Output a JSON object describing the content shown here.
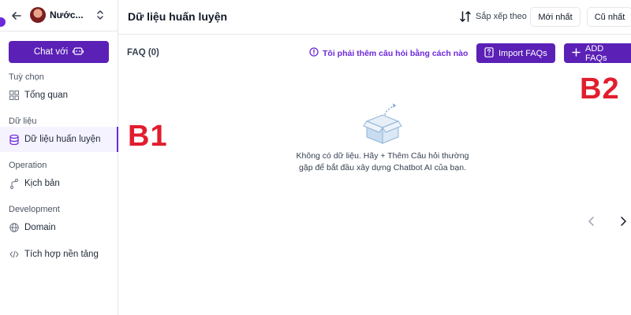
{
  "sidebar": {
    "account_name": "Nước...",
    "chat_button": "Chat với",
    "sections": {
      "options": "Tuỳ chọn",
      "data": "Dữ liệu",
      "operation": "Operation",
      "development": "Development"
    },
    "items": {
      "overview": "Tổng quan",
      "training": "Dữ liệu huấn luyện",
      "scenario": "Kịch bản",
      "domain": "Domain",
      "integration": "Tích hợp nền tảng"
    }
  },
  "header": {
    "title": "Dữ liệu huấn luyện",
    "sort_label": "Sắp xếp theo",
    "sort_newest": "Mới nhất",
    "sort_oldest": "Cũ nhất"
  },
  "content": {
    "faq_title": "FAQ (0)",
    "help_link": "Tôi phải thêm câu hỏi bằng cách nào",
    "import_button": "Import FAQs",
    "add_button": "ADD FAQs",
    "empty_line1": "Không có dữ liệu. Hãy + Thêm Câu hỏi thường",
    "empty_line2": "gặp để bắt đầu xây dựng Chatbot AI của bạn."
  },
  "annotations": {
    "b1": "B1",
    "b2": "B2"
  },
  "colors": {
    "accent": "#5b21b6",
    "annotation": "#e11d2e"
  }
}
